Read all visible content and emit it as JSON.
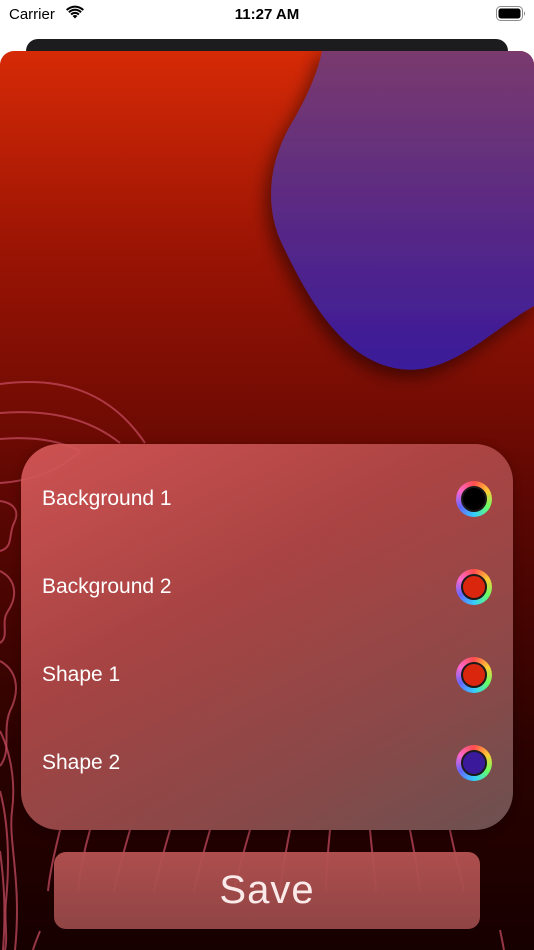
{
  "status_bar": {
    "carrier": "Carrier",
    "time": "11:27 AM",
    "icons": [
      "wifi-icon",
      "battery-icon"
    ]
  },
  "settings": {
    "rows": [
      {
        "label": "Background 1",
        "color": "#000000"
      },
      {
        "label": "Background 2",
        "color": "#d9260c"
      },
      {
        "label": "Shape 1",
        "color": "#d9260c"
      },
      {
        "label": "Shape 2",
        "color": "#3a1a9a"
      }
    ]
  },
  "save_label": "Save",
  "colors": {
    "background_top": "#d62a06",
    "background_bottom": "#170000",
    "blob_top": "#7a3a6e",
    "blob_bottom": "#3a1a9a"
  }
}
